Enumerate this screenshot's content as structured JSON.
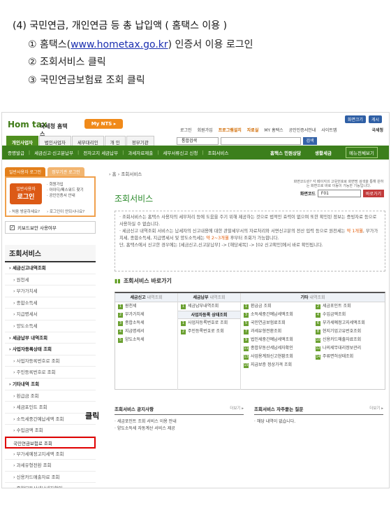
{
  "intro": {
    "heading": "(4)   국민연금, 개인연금 등 총 납입액 ( 홈택스 이용 )",
    "step1_prefix": "① 홈택스(",
    "step1_link": "www.hometax.go.kr",
    "step1_suffix": ") 인증서 이용 로그인",
    "step2": "② 조회서비스 클릭",
    "step3": "③ 국민연금보험료 조회 클릭"
  },
  "header": {
    "logo": "Hom tax",
    "agency": "국세청 홈택스",
    "mynts": "My NTS ▸",
    "top_buttons": [
      "화면크기",
      "게시"
    ],
    "utility_links": [
      "로그인",
      "회원가입",
      "프로그램설치",
      "자료실",
      "MY 홈택스",
      "공인인증서안내",
      "사이트맵"
    ],
    "nts_label": "국세청",
    "gnb_tabs": [
      "개인사업자",
      "법인사업자",
      "세무대리인",
      "개 인",
      "정부기관"
    ],
    "search_select": "통합검색",
    "search_button": "검색"
  },
  "subnav": {
    "items": [
      "증명발급",
      "세금신고·신고분납부",
      "전자고지 세금납부",
      "과세자료제출",
      "세무서류신고 신청",
      "조회서비스"
    ],
    "right1": "홈택스 민원상담",
    "right2": "생활세금",
    "right3": "메뉴전체보기"
  },
  "left": {
    "tab_active": "일반사용자 로그인",
    "tab_inactive": "정부기관 로그인",
    "login_sub": "일반사용자",
    "login_main": "로그인",
    "links": [
      "· 회원가입",
      "· 아이디/패스워드 찾기",
      "· 공인인증서 안내"
    ],
    "foot": [
      "› 처음 방문하세요?",
      "› 로그인이 안되시나요?"
    ],
    "keyboard": "키보드보안 사용여부",
    "title": "조회서비스",
    "menu": [
      {
        "label": "› 세금신고내역조회",
        "type": "cat"
      },
      {
        "label": "› 원천세",
        "type": "sub"
      },
      {
        "label": "› 부가가치세",
        "type": "sub"
      },
      {
        "label": "› 종합소득세",
        "type": "sub"
      },
      {
        "label": "› 지급명세서",
        "type": "sub"
      },
      {
        "label": "› 양도소득세",
        "type": "sub"
      },
      {
        "label": "› 세금납부 내역조회",
        "type": "cat"
      },
      {
        "label": "› 사업자등록상태 조회",
        "type": "cat"
      },
      {
        "label": "› 사업자등록번호로 조회",
        "type": "sub"
      },
      {
        "label": "› 주민등록번호로 조회",
        "type": "sub"
      },
      {
        "label": "› 기타내역 조회",
        "type": "cat"
      },
      {
        "label": "› 환급금 조회",
        "type": "sub"
      },
      {
        "label": "› 세금포인트 조회",
        "type": "sub"
      },
      {
        "label": "› 소득세중간예납세액 조회",
        "type": "sub"
      },
      {
        "label": "› 수입금액 조회",
        "type": "sub"
      },
      {
        "label": "국민연금보험료 조회",
        "type": "hit"
      },
      {
        "label": "› 부가세예정고지세액 조회",
        "type": "sub"
      },
      {
        "label": "› 과세유형전환 조회",
        "type": "sub"
      },
      {
        "label": "› 신용카드매출자료 조회",
        "type": "sub"
      },
      {
        "label": "› 종합부동산세납세자확인",
        "type": "sub"
      }
    ],
    "click_label": "클릭"
  },
  "main": {
    "breadcrumb": "› 홈 › 조회서비스",
    "help_title": "화면코드란?  각 페이지의 고유번호로 화면명 검색을 통해 원하는 화면으로 바로 이동이 가능한 기능입니다.",
    "title": "조회서비스",
    "page_code_label": "화면코드",
    "page_code_value": "F01",
    "page_code_button": "바로가기",
    "notice_1": "· 조회서비스는 홈택스 사용자의 세무처리 등에 도움을 주기 위해 제공하는 것으로 법적인 효력이 없으며 또한 확인된 정보는 증빙자료 등으로 사용하실 수 없습니다.",
    "notice_2a": "· 세금신고 내역조회 서비스는 납세자의 신고내용에 대한 관할세무서의 자료처리와 서면신고분의 전산 입력 등으로 원천세는 ",
    "notice_2b": "약 1개월",
    "notice_2c": ", 부가가치세, 종합소득세, 지급명세서 및 양도소득세는 ",
    "notice_2d": "약 2~3개월",
    "notice_2e": " 후부터 조회가 가능합니다.",
    "notice_3": "  단, 홈택스에서 신고한 경우에는 [세금신고,신고분납부] -> [해당세목] -> [02 신고확인]에서 바로 확인됩니다.",
    "shortcut_title": "조회서비스 바로가기",
    "col1_head": "세금신고",
    "col1_head2": " 내역조회",
    "col1_items": [
      "원천세",
      "부가가치세",
      "종합소득세",
      "지급명세서",
      "양도소득세"
    ],
    "col2_head": "세금납부",
    "col2_head2": " 내역조회",
    "col2_items": [
      "세금납부내역조회"
    ],
    "col2_sub": "사업자등록",
    "col2_sub2": " 상태조회",
    "col2_sub_items": [
      "사업자등록번호로 조회",
      "주민등록번호로 조회"
    ],
    "col3_head": "기타",
    "col3_head2": " 내역조회",
    "col3_left": [
      "환급금 조회",
      "소득세중간예납세액조회",
      "국민연금보험료조회",
      "과세유형전환조회",
      "법인세중간예납세액조회",
      "종합부동산세납세자확인",
      "사업용계좌신고현황조회",
      "지급보증 정상가격 조회"
    ],
    "col3_right": [
      "세금포인트 조회",
      "수입금액조회",
      "부가세예정고지세액조회",
      "현지기업고유번호조회",
      "신용카드매출자료조회",
      "나의세무대리정보관리",
      "주류면허상태조회"
    ],
    "notice_box_title": "조회서비스 공지사항",
    "notice_box_more": "더보기 ▸",
    "notice_box_items": [
      "· 세금포인트 조회 서비스 이용 안내",
      "· 양도소득세 자동계산 서비스 제공"
    ],
    "faq_title": "조회서비스 자주묻는 질문",
    "faq_more": "더보기 ▸",
    "faq_items": [
      "· 해당 내역이 없습니다."
    ]
  },
  "colors": {
    "green": "#3c7f1c",
    "orange": "#e37f1b",
    "red_box": "#e00000"
  }
}
